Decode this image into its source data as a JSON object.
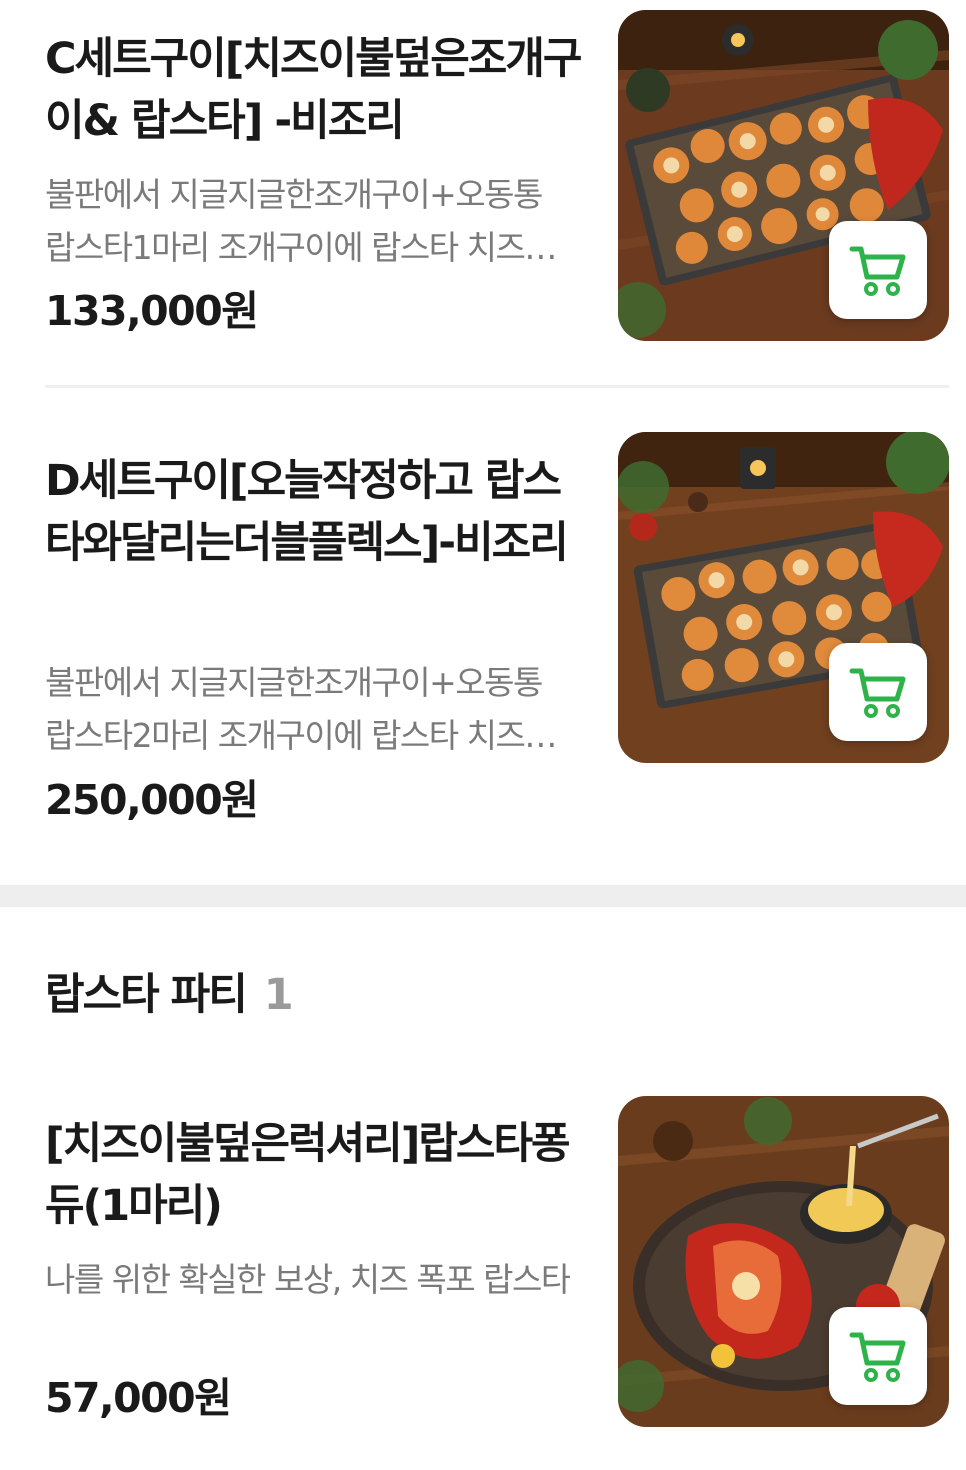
{
  "section": {
    "title": "랍스타 파티",
    "count": "1"
  },
  "items": [
    {
      "name": "C세트구이[치즈이불덮은조개구이& 랍스타] -비조리",
      "description": "불판에서 지글지글한조개구이+오동통랍스타1마리 조개구이에 랍스타 치즈이불까지 덮은 세트",
      "price": "133,000원",
      "image_icon": "seafood-grill-photo",
      "cart_icon": "cart-icon"
    },
    {
      "name": "D세트구이[오늘작정하고 랍스타와달리는더블플렉스]-비조리",
      "description": "불판에서 지글지글한조개구이+오동통랍스타2마리 조개구이에 랍스타 치즈이불까지 덮은 세트",
      "price": "250,000원",
      "image_icon": "seafood-grill-photo",
      "cart_icon": "cart-icon"
    },
    {
      "name": "[치즈이불덮은럭셔리]랍스타퐁듀(1마리)",
      "description": "나를 위한 확실한 보상, 치즈 폭포 랍스타",
      "price": "57,000원",
      "image_icon": "lobster-fondue-photo",
      "cart_icon": "cart-icon"
    }
  ],
  "colors": {
    "cart_green": "#2db34a",
    "price": "#1a1a1a",
    "desc": "#7a7a7a"
  }
}
